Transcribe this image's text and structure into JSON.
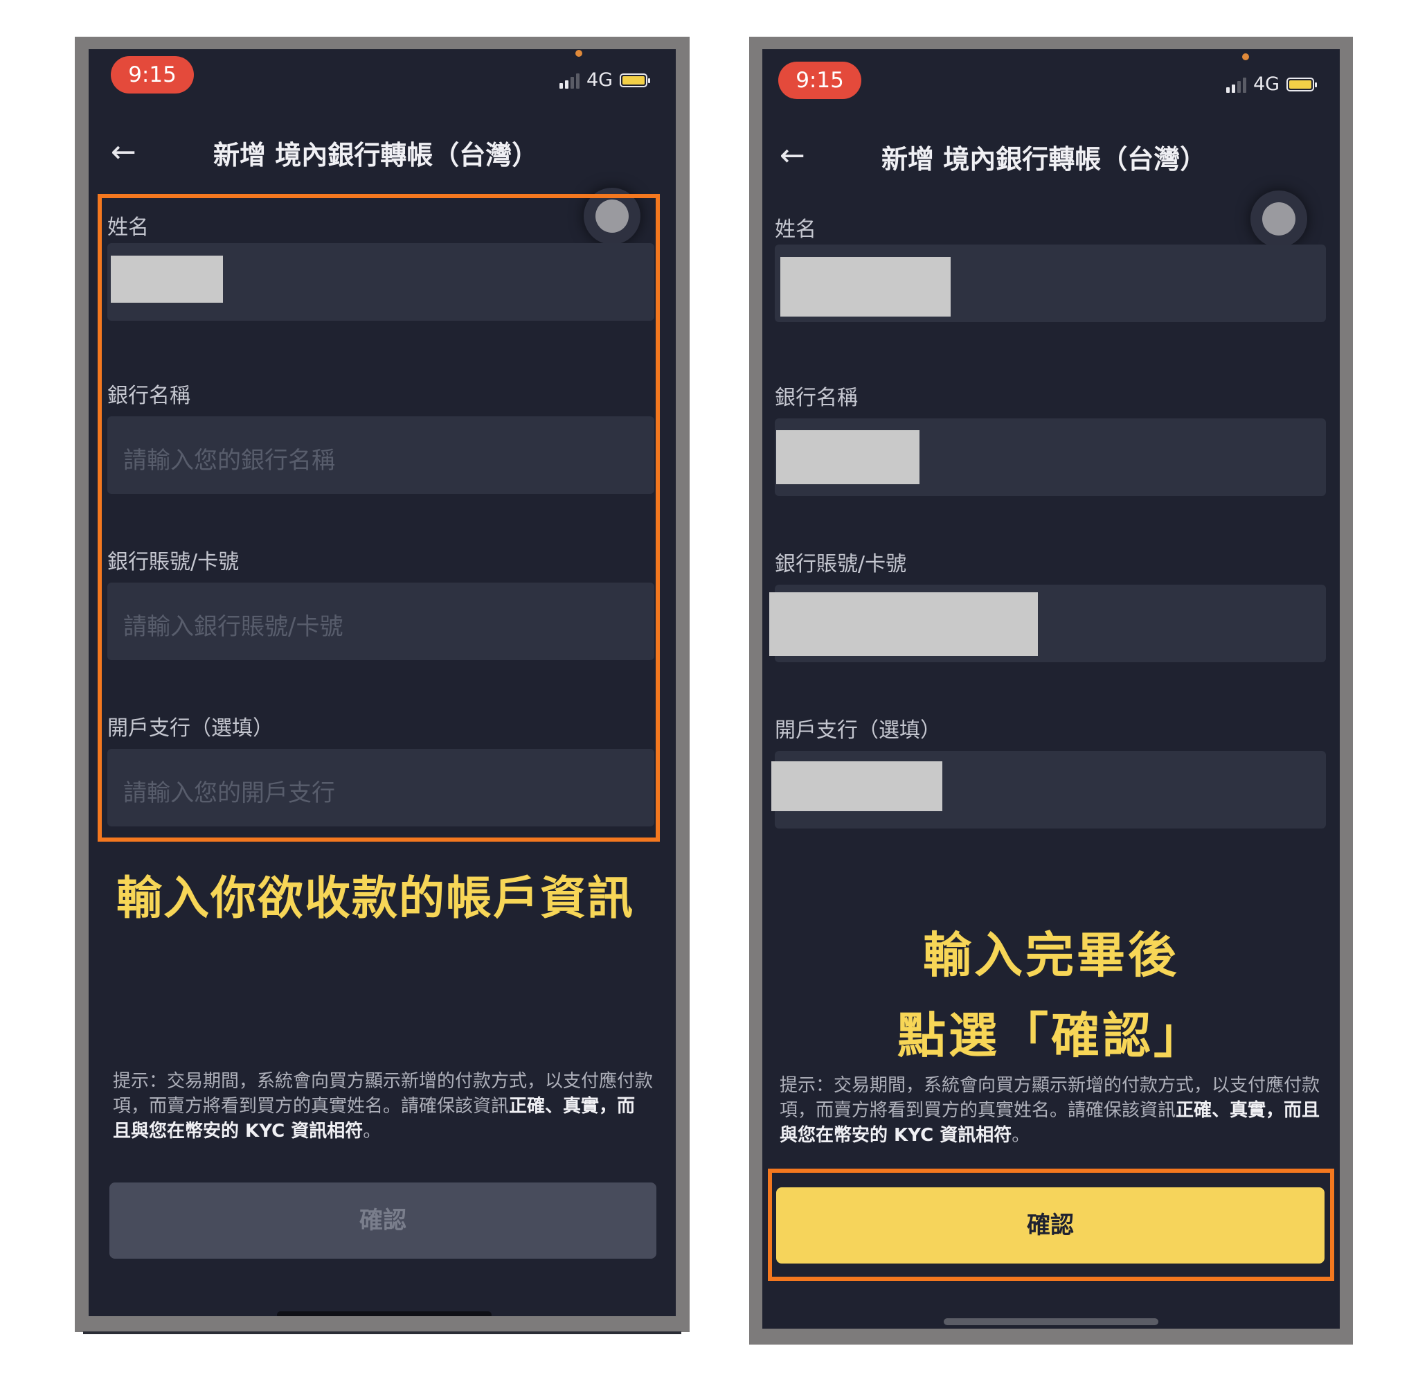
{
  "status_bar": {
    "time": "9:15",
    "network": "4G"
  },
  "header": {
    "back_icon": "arrow-left-icon",
    "title": "新增 境內銀行轉帳（台灣）"
  },
  "form": {
    "name_label": "姓名",
    "bank_name_label": "銀行名稱",
    "bank_name_placeholder": "請輸入您的銀行名稱",
    "account_label": "銀行賬號/卡號",
    "account_placeholder": "請輸入銀行賬號/卡號",
    "branch_label": "開戶支行（選填）",
    "branch_placeholder": "請輸入您的開戶支行"
  },
  "hint": {
    "text": "提示：交易期間，系統會向買方顯示新增的付款方式，以支付應付款項，而賣方將看到買方的真實姓名。請確保該資訊",
    "bold1": "正確",
    "sep": "、",
    "bold2": "真實，而且與您在幣安的 KYC 資訊相符",
    "end": "。"
  },
  "confirm_label": "確認",
  "captions": {
    "left": "輸入你欲收款的帳戶資訊",
    "right_line1": "輸入完畢後",
    "right_line2": "點選「確認」"
  },
  "colors": {
    "highlight": "#f4781f",
    "caption": "#f7d657",
    "confirm_active": "#f6d45b",
    "background": "#1f2230"
  }
}
